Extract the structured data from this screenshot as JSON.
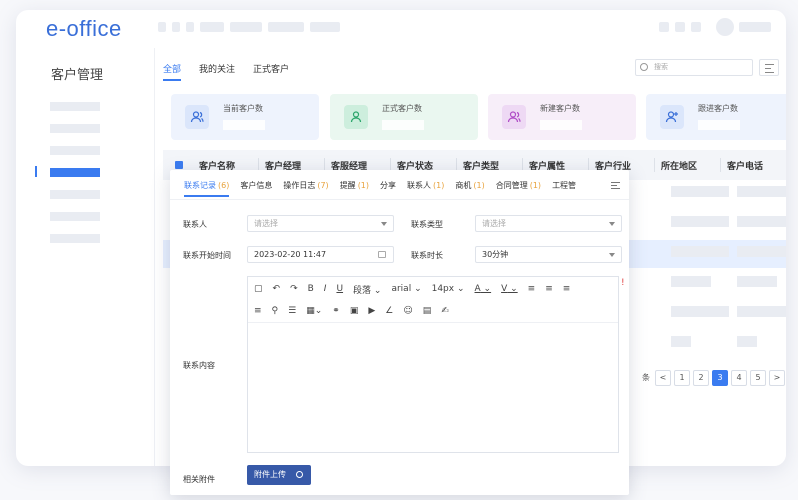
{
  "app": {
    "logo": "e-office"
  },
  "sidebar": {
    "title": "客户管理"
  },
  "main": {
    "tabs": [
      "全部",
      "我的关注",
      "正式客户"
    ],
    "search_placeholder": "搜索"
  },
  "stats": [
    {
      "label": "当前客户数",
      "icon": "users-icon",
      "bg": "#eef3fd",
      "icon_bg": "#dbe6fb",
      "icon_color": "#3a6fd8"
    },
    {
      "label": "正式客户数",
      "icon": "user-icon",
      "bg": "#eaf7f0",
      "icon_bg": "#cdeedd",
      "icon_color": "#2aa56a"
    },
    {
      "label": "新建客户数",
      "icon": "users-icon",
      "bg": "#f7eef9",
      "icon_bg": "#eed9f4",
      "icon_color": "#b04cc7"
    },
    {
      "label": "跟进客户数",
      "icon": "user-add-icon",
      "bg": "#eef3fd",
      "icon_bg": "#dbe6fb",
      "icon_color": "#3a6fd8"
    }
  ],
  "table": {
    "columns": [
      "客户名称",
      "客户经理",
      "客服经理",
      "客户状态",
      "客户类型",
      "客户属性",
      "客户行业",
      "所在地区",
      "客户电话"
    ]
  },
  "pager": {
    "suffix": "条",
    "pages": [
      "1",
      "2",
      "3",
      "4",
      "5"
    ],
    "active": "3"
  },
  "dialog": {
    "tabs": [
      {
        "label": "联系记录",
        "count": "(6)"
      },
      {
        "label": "客户信息",
        "count": ""
      },
      {
        "label": "操作日志",
        "count": "(7)"
      },
      {
        "label": "提醒",
        "count": "(1)"
      },
      {
        "label": "分享",
        "count": ""
      },
      {
        "label": "联系人",
        "count": "(1)"
      },
      {
        "label": "商机",
        "count": "(1)"
      },
      {
        "label": "合同管理",
        "count": "(1)"
      },
      {
        "label": "工程管",
        "count": ""
      }
    ],
    "contact_label": "联系人",
    "contact_placeholder": "请选择",
    "type_label": "联系类型",
    "type_placeholder": "请选择",
    "start_label": "联系开始时间",
    "start_value": "2023-02-20 11:47",
    "duration_label": "联系时长",
    "duration_value": "30分钟",
    "content_label": "联系内容",
    "toolbar": {
      "paragraph": "段落",
      "font": "arial",
      "size": "14px",
      "bold": "B",
      "italic": "I",
      "underline": "U",
      "font_color": "A",
      "highlight": "V"
    },
    "required_mark": "!",
    "attach_label": "相关附件",
    "upload_label": "附件上传"
  }
}
